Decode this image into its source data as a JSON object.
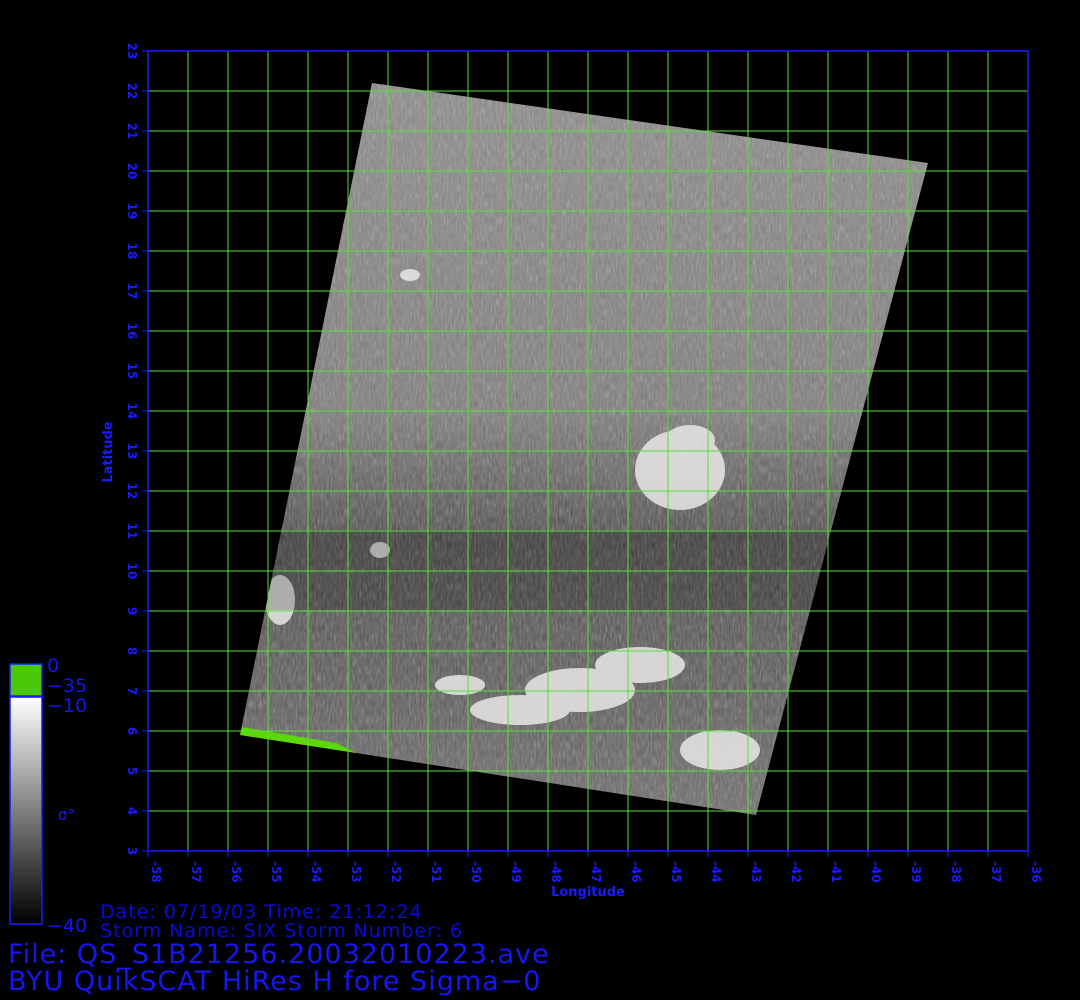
{
  "map": {
    "xlabel": "Longitude",
    "ylabel": "Latitude",
    "lon_ticks": [
      -58,
      -57,
      -56,
      -55,
      -54,
      -53,
      -52,
      -51,
      -50,
      -49,
      -48,
      -47,
      -46,
      -45,
      -44,
      -43,
      -42,
      -41,
      -40,
      -39,
      -38,
      -37,
      -36
    ],
    "lat_ticks": [
      3,
      4,
      5,
      6,
      7,
      8,
      9,
      10,
      11,
      12,
      13,
      14,
      15,
      16,
      17,
      18,
      19,
      20,
      21,
      22,
      23
    ],
    "lon_range": [
      -58,
      -36
    ],
    "lat_range": [
      3,
      23
    ],
    "grid": true,
    "grid_color": "#58e030",
    "axis_color": "#1a1aff",
    "swath_corners": [
      [
        -52.4,
        22.2
      ],
      [
        -38.5,
        20.2
      ],
      [
        -42.8,
        3.9
      ],
      [
        -55.7,
        5.9
      ]
    ],
    "saturated_color": "#5ad80a"
  },
  "colorbar": {
    "symbol": "σ°",
    "labels": {
      "top": "0",
      "sat": "−35",
      "high": "−10",
      "low": "−40"
    }
  },
  "info": {
    "date_line": "Date: 07/19/03  Time: 21:12:24",
    "storm_line": "Storm Name: SIX   Storm Number: 6",
    "file_line": "File: QS_S1B21256.20032010223.ave",
    "product_line": "BYU QuikSCAT HiRes H fore Sigma−0"
  }
}
